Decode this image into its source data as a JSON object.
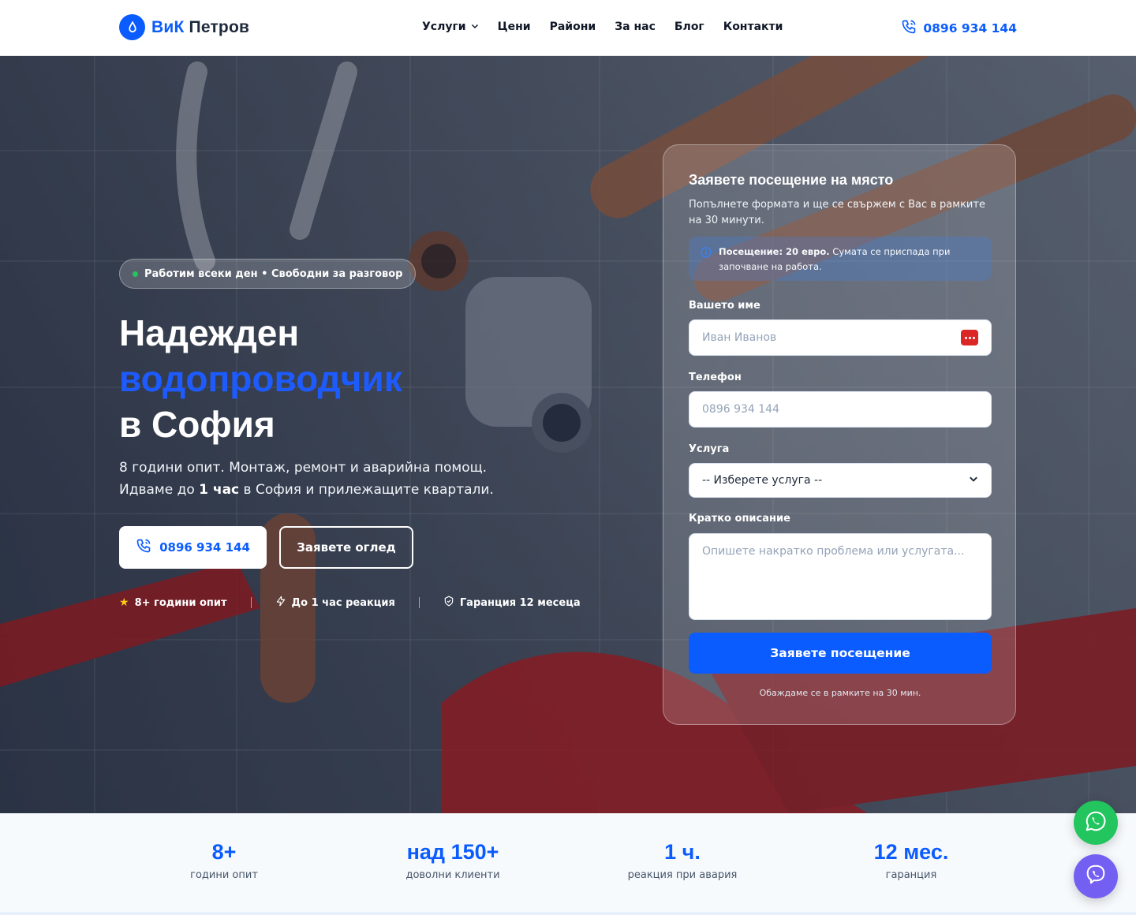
{
  "brand": {
    "part1": "ВиК",
    "part2": "Петров"
  },
  "nav": [
    {
      "label": "Услуги",
      "has_dropdown": true
    },
    {
      "label": "Цени"
    },
    {
      "label": "Райони"
    },
    {
      "label": "За нас"
    },
    {
      "label": "Блог"
    },
    {
      "label": "Контакти"
    }
  ],
  "header": {
    "phone": "0896 934 144"
  },
  "hero": {
    "badge": "Работим всеки ден • Свободни за разговор",
    "title_line1": "Надежден",
    "title_accent": "водопроводчик",
    "title_line3": "в София",
    "lead_line1": "8 години опит. Монтаж, ремонт и аварийна помощ.",
    "lead_prefix": "Идваме до ",
    "lead_bold": "1 час",
    "lead_suffix": " в София и прилежащите квартали.",
    "call_button": "0896 934 144",
    "inspect_button": "Заявете оглед",
    "features": [
      "8+ години опит",
      "До 1 час реакция",
      "Гаранция 12 месеца"
    ]
  },
  "form": {
    "title": "Заявете посещение на място",
    "subtitle": "Попълнете формата и ще се свържем с Вас в рамките на 30 минути.",
    "info_bold": "Посещение: 20 евро.",
    "info_text": " Сумата се приспада при започване на работа.",
    "name_label": "Вашето име",
    "name_placeholder": "Иван Иванов",
    "phone_label": "Телефон",
    "phone_placeholder": "0896 934 144",
    "service_label": "Услуга",
    "service_selected": "-- Изберете услуга --",
    "desc_label": "Кратко описание",
    "desc_placeholder": "Опишете накратко проблема или услугата...",
    "submit": "Заявете посещение",
    "note": "Обаждаме се в рамките на 30 мин."
  },
  "stats": [
    {
      "value": "8+",
      "label": "години опит"
    },
    {
      "value": "над 150+",
      "label": "доволни клиенти"
    },
    {
      "value": "1 ч.",
      "label": "реакция при авария"
    },
    {
      "value": "12 мес.",
      "label": "гаранция"
    }
  ],
  "colors": {
    "accent": "#0b5cff",
    "whatsapp": "#22c55e",
    "viber": "#7360f2"
  },
  "icons": [
    "droplet-icon",
    "chevron-down-icon",
    "phone-icon",
    "info-icon",
    "star-icon",
    "bolt-icon",
    "shield-icon",
    "password-manager-icon",
    "whatsapp-icon",
    "viber-icon"
  ]
}
